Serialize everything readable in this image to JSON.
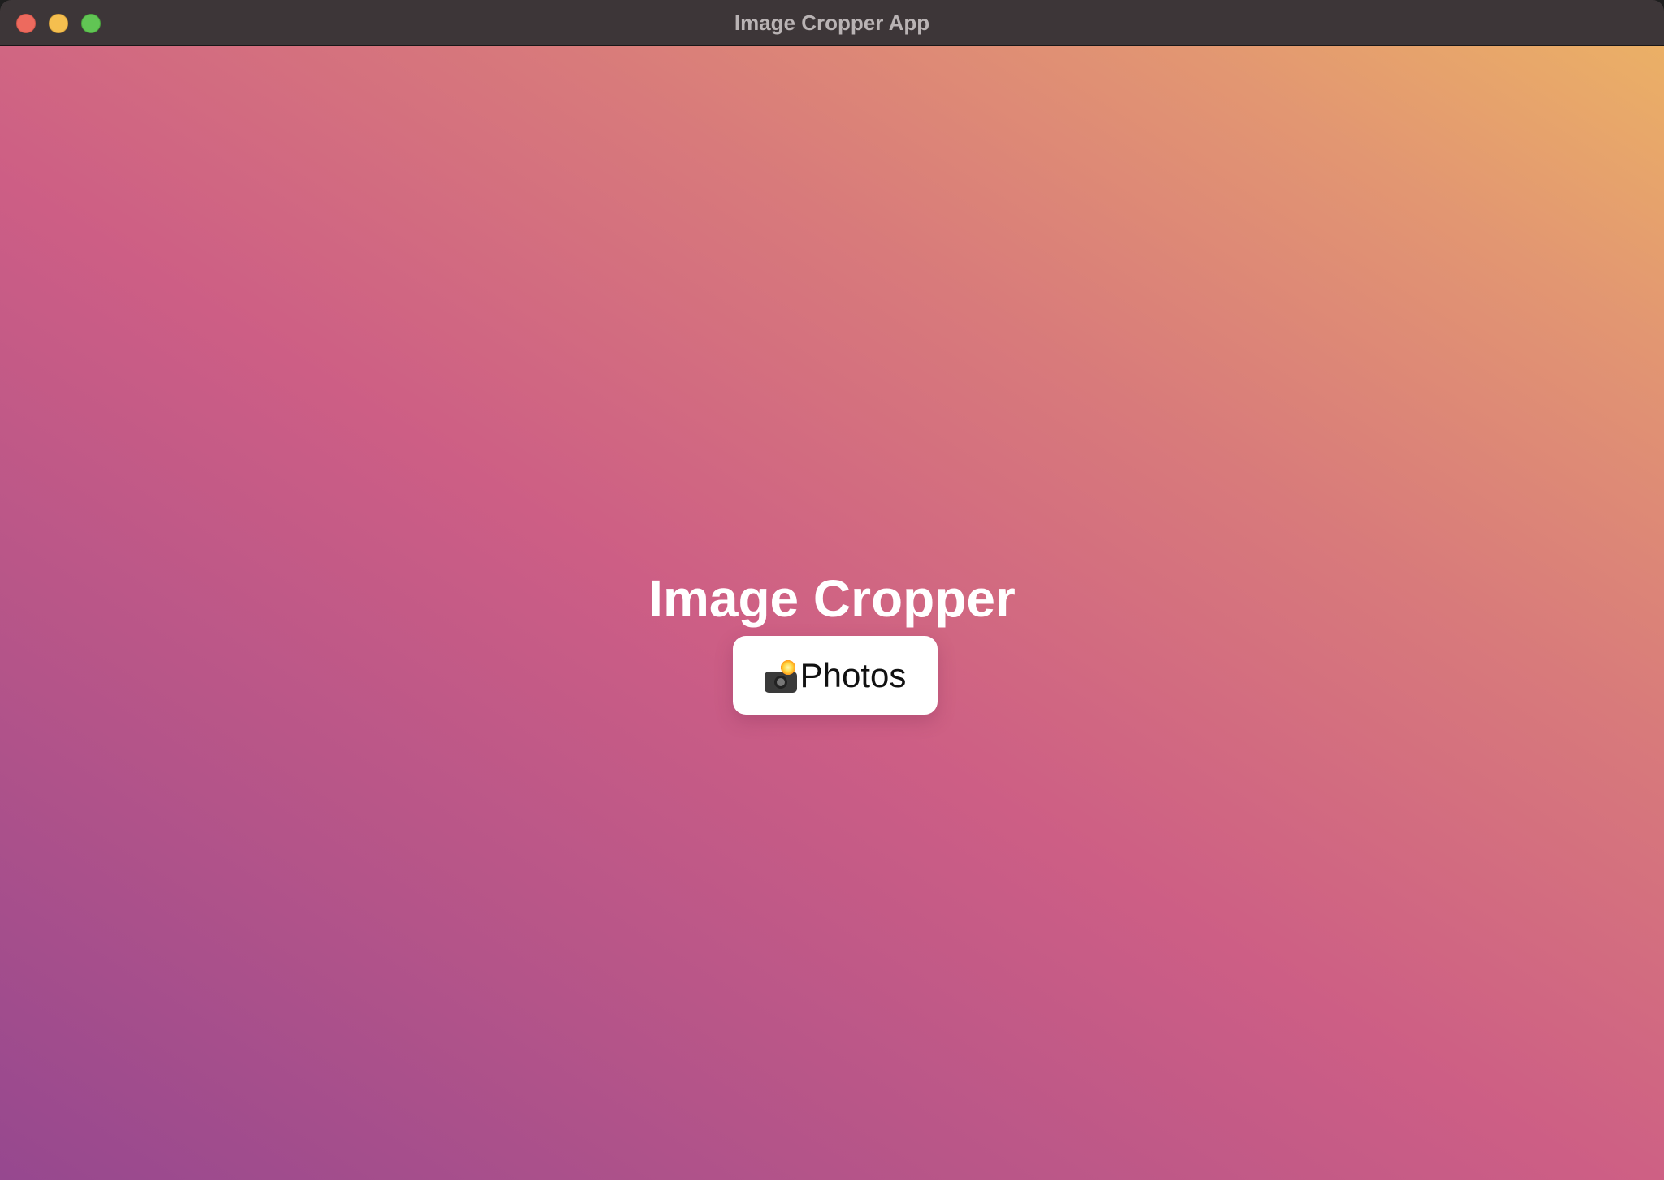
{
  "window": {
    "title": "Image Cropper App"
  },
  "main": {
    "heading": "Image Cropper",
    "photos_button": {
      "icon": "camera-flash-icon",
      "label": "Photos"
    }
  },
  "colors": {
    "gradient_start": "#96488f",
    "gradient_mid": "#cd5e85",
    "gradient_end": "#ebb066",
    "titlebar": "#3d3638",
    "button_bg": "#ffffff",
    "heading_text": "#ffffff"
  }
}
